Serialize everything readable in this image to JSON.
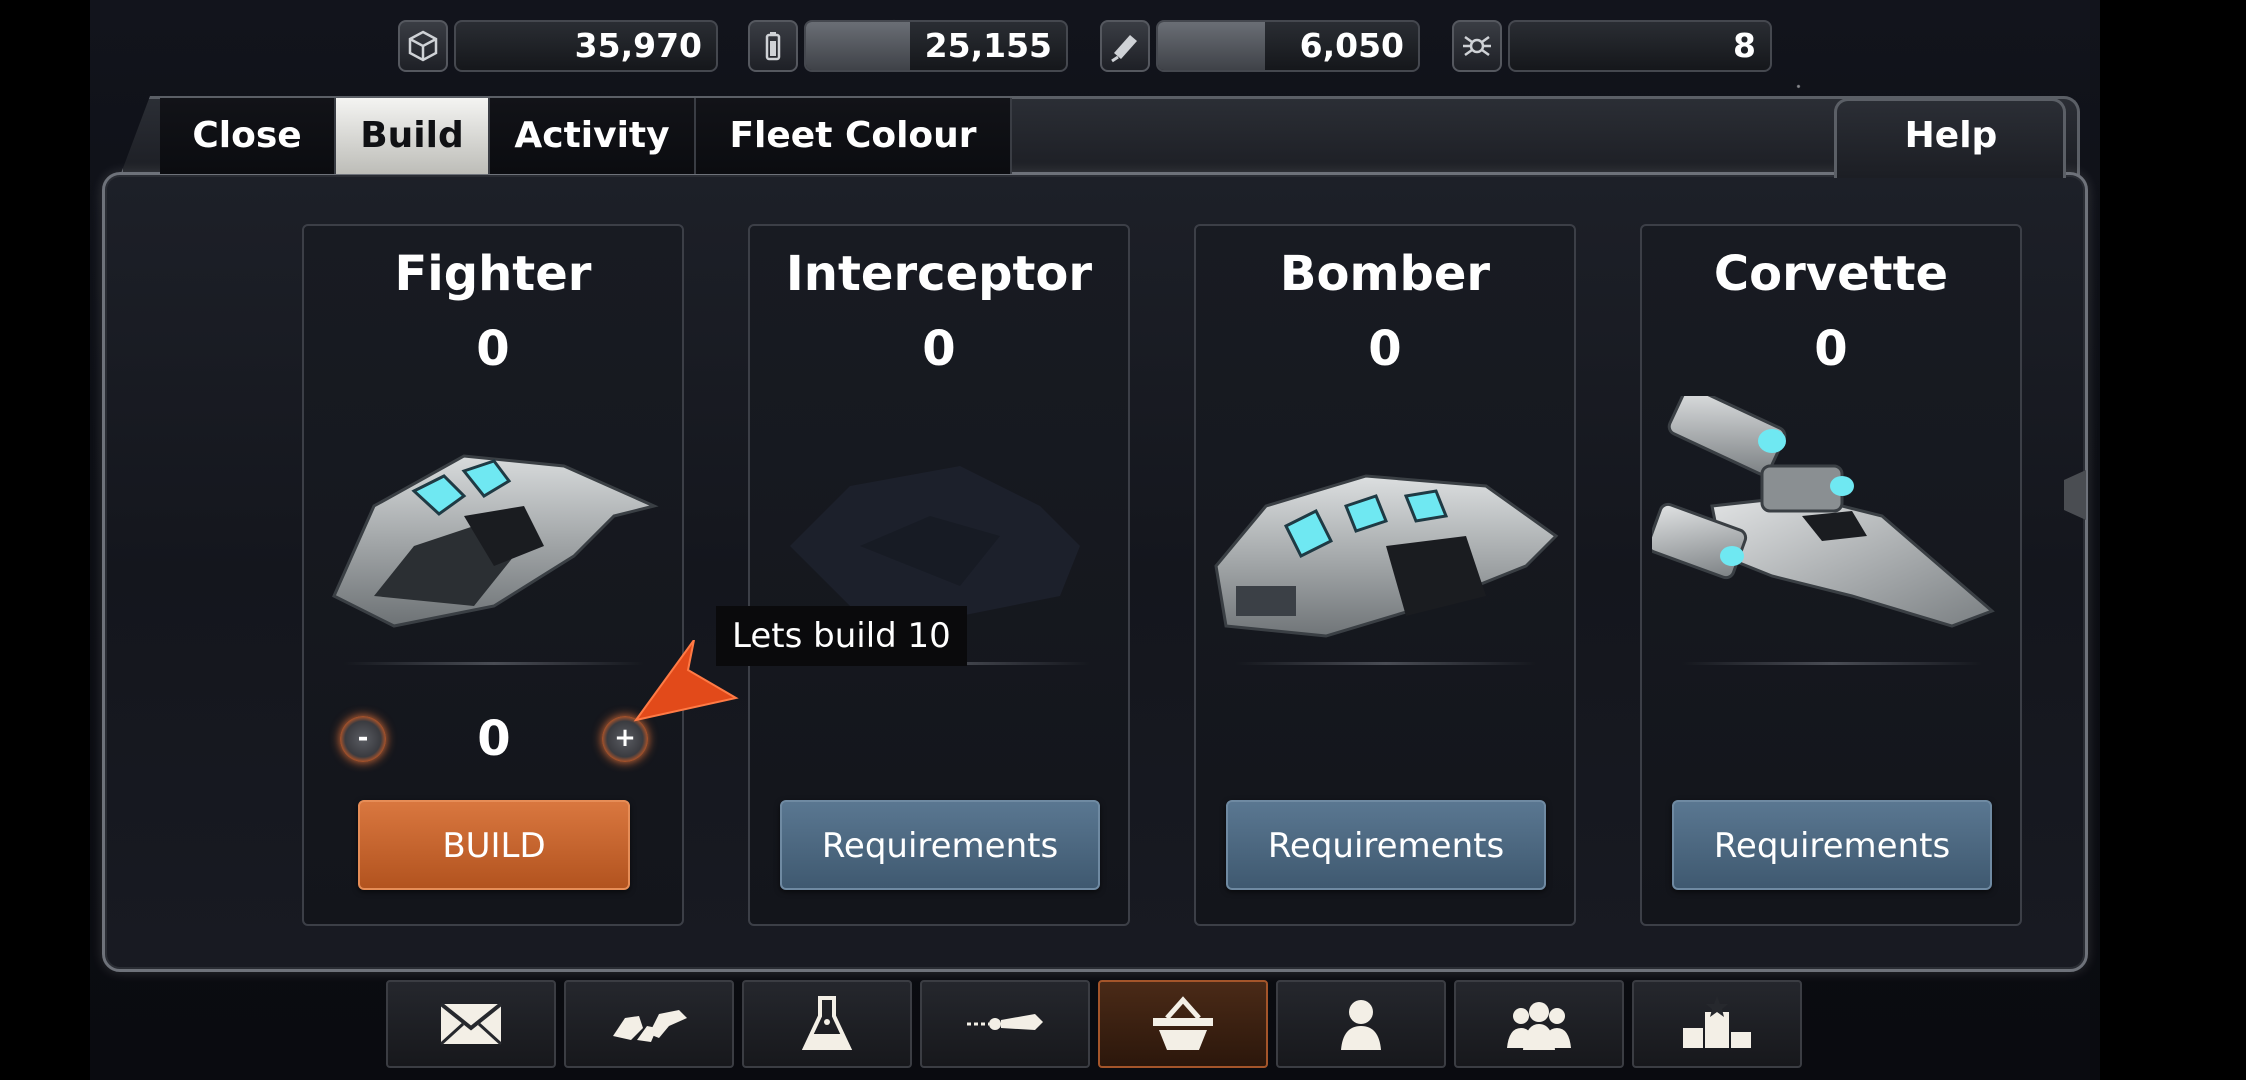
{
  "resources": [
    {
      "icon": "cube-icon",
      "value": "35,970",
      "fill": 0.0
    },
    {
      "icon": "battery-icon",
      "value": "25,155",
      "fill": 0.4
    },
    {
      "icon": "crystal-icon",
      "value": "6,050",
      "fill": 0.41
    },
    {
      "icon": "crew-icon",
      "value": "8",
      "fill": 0.0
    }
  ],
  "tabs": {
    "close": "Close",
    "build": "Build",
    "activity": "Activity",
    "fleet_colour": "Fleet Colour",
    "help": "Help",
    "active": "Build"
  },
  "ships": [
    {
      "name": "Fighter",
      "count": "0",
      "available": true,
      "quantity": "0",
      "action_label": "BUILD",
      "decrement": "-",
      "increment": "+"
    },
    {
      "name": "Interceptor",
      "count": "0",
      "available": false,
      "action_label": "Requirements"
    },
    {
      "name": "Bomber",
      "count": "0",
      "available": false,
      "action_label": "Requirements"
    },
    {
      "name": "Corvette",
      "count": "0",
      "available": false,
      "action_label": "Requirements"
    }
  ],
  "tooltip": {
    "text": "Lets build 10"
  },
  "bottom_nav": [
    {
      "icon": "mail-icon"
    },
    {
      "icon": "fleet-icon"
    },
    {
      "icon": "research-flask-icon"
    },
    {
      "icon": "weapon-icon"
    },
    {
      "icon": "shipyard-basket-icon",
      "active": true
    },
    {
      "icon": "profile-icon"
    },
    {
      "icon": "alliance-icon"
    },
    {
      "icon": "leaderboard-icon"
    }
  ],
  "colors": {
    "accent_orange": "#d9773f",
    "requirement_blue": "#4f6b84"
  }
}
